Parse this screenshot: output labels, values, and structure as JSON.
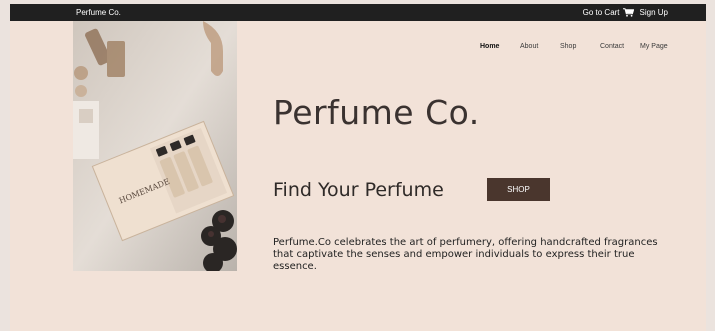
{
  "topbar": {
    "brand": "Perfume Co.",
    "cart_label": "Go to Cart",
    "signup_label": "Sign Up"
  },
  "nav": {
    "items": [
      "Home",
      "About",
      "Shop",
      "Contact",
      "My Page"
    ]
  },
  "hero": {
    "title": "Perfume Co.",
    "subtitle": "Find Your Perfume",
    "shop_button": "SHOP",
    "description": "Perfume.Co celebrates the art of perfumery, offering handcrafted fragrances that captivate the senses and empower individuals to express their true essence.",
    "image_box_text": "HOMEMADE"
  },
  "colors": {
    "topbar_bg": "#202020",
    "page_bg": "#f2e2d8",
    "button_bg": "#4a362d",
    "title_color": "#3a3230"
  }
}
